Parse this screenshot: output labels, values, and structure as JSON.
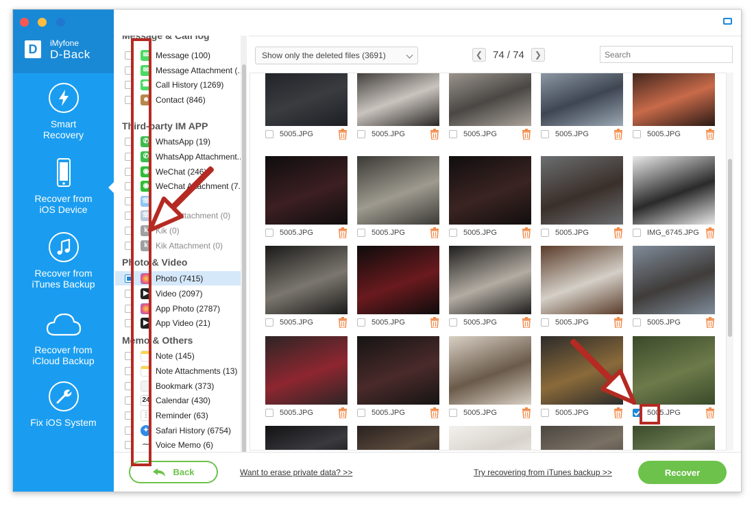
{
  "app": {
    "brand_small": "iMyfone",
    "brand_large": "D-Back",
    "logo_letter": "D"
  },
  "nav": [
    {
      "label_line1": "Smart",
      "label_line2": "Recovery",
      "icon": "lightning-icon"
    },
    {
      "label_line1": "Recover from",
      "label_line2": "iOS Device",
      "icon": "iphone-icon",
      "active": true
    },
    {
      "label_line1": "Recover from",
      "label_line2": "iTunes Backup",
      "icon": "music-note-icon"
    },
    {
      "label_line1": "Recover from",
      "label_line2": "iCloud Backup",
      "icon": "cloud-icon"
    },
    {
      "label_line1": "Fix iOS System",
      "label_line2": "",
      "icon": "wrench-icon"
    }
  ],
  "categories": {
    "sections": {
      "message": "Message & Call log",
      "third_party": "Third-party IM APP",
      "photo_video": "Photo & Video",
      "memo": "Memo & Others"
    },
    "message_items": [
      {
        "label": "Message (100)",
        "icon_color": "#4cd964"
      },
      {
        "label": "Message Attachment (..",
        "icon_color": "#4cd964"
      },
      {
        "label": "Call History (1269)",
        "icon_color": "#4cd964"
      },
      {
        "label": "Contact (846)",
        "icon_color": "#b8864a"
      }
    ],
    "im_items": [
      {
        "label": "WhatsApp (19)",
        "icon_color": "#3dbd4e"
      },
      {
        "label": "WhatsApp Attachment..",
        "icon_color": "#3dbd4e"
      },
      {
        "label": "WeChat (246)",
        "icon_color": "#2fbd35"
      },
      {
        "label": "WeChat Attachment (7..",
        "icon_color": "#2fbd35"
      },
      {
        "label": "",
        "icon_color": "#8fc6f0"
      },
      {
        "label": "Viber Attachment (0)",
        "icon_color": "#b9c8da"
      },
      {
        "label": "Kik (0)",
        "icon_color": "#a0a0a0"
      },
      {
        "label": "Kik Attachment (0)",
        "icon_color": "#a0a0a0"
      }
    ],
    "photo_items": [
      {
        "label": "Photo (7415)",
        "icon_color": "#f5a623"
      },
      {
        "label": "Video (2097)",
        "icon_color": "#222222"
      },
      {
        "label": "App Photo (2787)",
        "icon_color": "#f5a623"
      },
      {
        "label": "App Video (21)",
        "icon_color": "#222222"
      }
    ],
    "memo_items": [
      {
        "label": "Note (145)",
        "icon_color": "#ffd54a"
      },
      {
        "label": "Note Attachments (13)",
        "icon_color": "#ffd54a"
      },
      {
        "label": "Bookmark (373)",
        "icon_color": "#dddddd"
      },
      {
        "label": "Calendar (430)",
        "icon_color": "#ffffff",
        "icon_text": "24"
      },
      {
        "label": "Reminder (63)",
        "icon_color": "#ffffff"
      },
      {
        "label": "Safari History (6754)",
        "icon_color": "#2f8ae5"
      },
      {
        "label": "Voice Memo (6)",
        "icon_color": "#ffffff"
      }
    ]
  },
  "toolbar": {
    "filter_label": "Show only the deleted files (3691)",
    "page_current": "74",
    "page_sep": "/",
    "page_total": "74",
    "search_placeholder": "Search"
  },
  "photos": [
    {
      "name": "5005.JPG",
      "colors": [
        "#1c1f24",
        "#3a3c40"
      ]
    },
    {
      "name": "5005.JPG",
      "colors": [
        "#2a2624",
        "#c9c4be"
      ]
    },
    {
      "name": "5005.JPG",
      "colors": [
        "#aaa39b",
        "#4a4744"
      ]
    },
    {
      "name": "5005.JPG",
      "colors": [
        "#9aa7b3",
        "#3e4652"
      ]
    },
    {
      "name": "5005.JPG",
      "colors": [
        "#2a1a15",
        "#c86a4a"
      ]
    },
    {
      "name": "5005.JPG",
      "colors": [
        "#0f0d0e",
        "#3c1f22"
      ]
    },
    {
      "name": "5005.JPG",
      "colors": [
        "#3b3a36",
        "#9e9a8f"
      ]
    },
    {
      "name": "5005.JPG",
      "colors": [
        "#110e0e",
        "#3a2422"
      ]
    },
    {
      "name": "5005.JPG",
      "colors": [
        "#6b6e70",
        "#3a2f2a"
      ]
    },
    {
      "name": "IMG_6745.JPG",
      "colors": [
        "#e8e8e8",
        "#2a2a2a"
      ]
    },
    {
      "name": "5005.JPG",
      "colors": [
        "#1b1a19",
        "#7b776f"
      ]
    },
    {
      "name": "5005.JPG",
      "colors": [
        "#0e0c0c",
        "#6a1a1e"
      ]
    },
    {
      "name": "5005.JPG",
      "colors": [
        "#1e1d1d",
        "#b3aca2"
      ]
    },
    {
      "name": "5005.JPG",
      "colors": [
        "#5a3c2a",
        "#d4cfc7"
      ]
    },
    {
      "name": "5005.JPG",
      "colors": [
        "#7f8b99",
        "#3f3c3a"
      ]
    },
    {
      "name": "5005.JPG",
      "colors": [
        "#2d2525",
        "#8e2630"
      ]
    },
    {
      "name": "5005.JPG",
      "colors": [
        "#161414",
        "#4a2a2a"
      ]
    },
    {
      "name": "5005.JPG",
      "colors": [
        "#d8d0c4",
        "#6a5a4a"
      ]
    },
    {
      "name": "5005.JPG",
      "colors": [
        "#2c2b2a",
        "#8a6a3a"
      ]
    },
    {
      "name": "5005.JPG",
      "colors": [
        "#3a4a2a",
        "#6d7a4a"
      ],
      "checked": true
    },
    {
      "name": "",
      "colors": [
        "#121214",
        "#3a3a3e"
      ]
    },
    {
      "name": "",
      "colors": [
        "#2a2220",
        "#5a4a3c"
      ]
    },
    {
      "name": "",
      "colors": [
        "#f3f1ee",
        "#d8d3cc"
      ]
    },
    {
      "name": "",
      "colors": [
        "#4a4640",
        "#7a7064"
      ]
    },
    {
      "name": "",
      "colors": [
        "#3a4a2c",
        "#6a7a50"
      ]
    }
  ],
  "footer": {
    "back_label": "Back",
    "erase_link": "Want to erase private data? >>",
    "itunes_link": "Try recovering from iTunes backup >>",
    "recover_label": "Recover"
  },
  "colors": {
    "nav_blue": "#1a9df0",
    "accent_green": "#6cc24a",
    "annotation_red": "#b52a22"
  }
}
